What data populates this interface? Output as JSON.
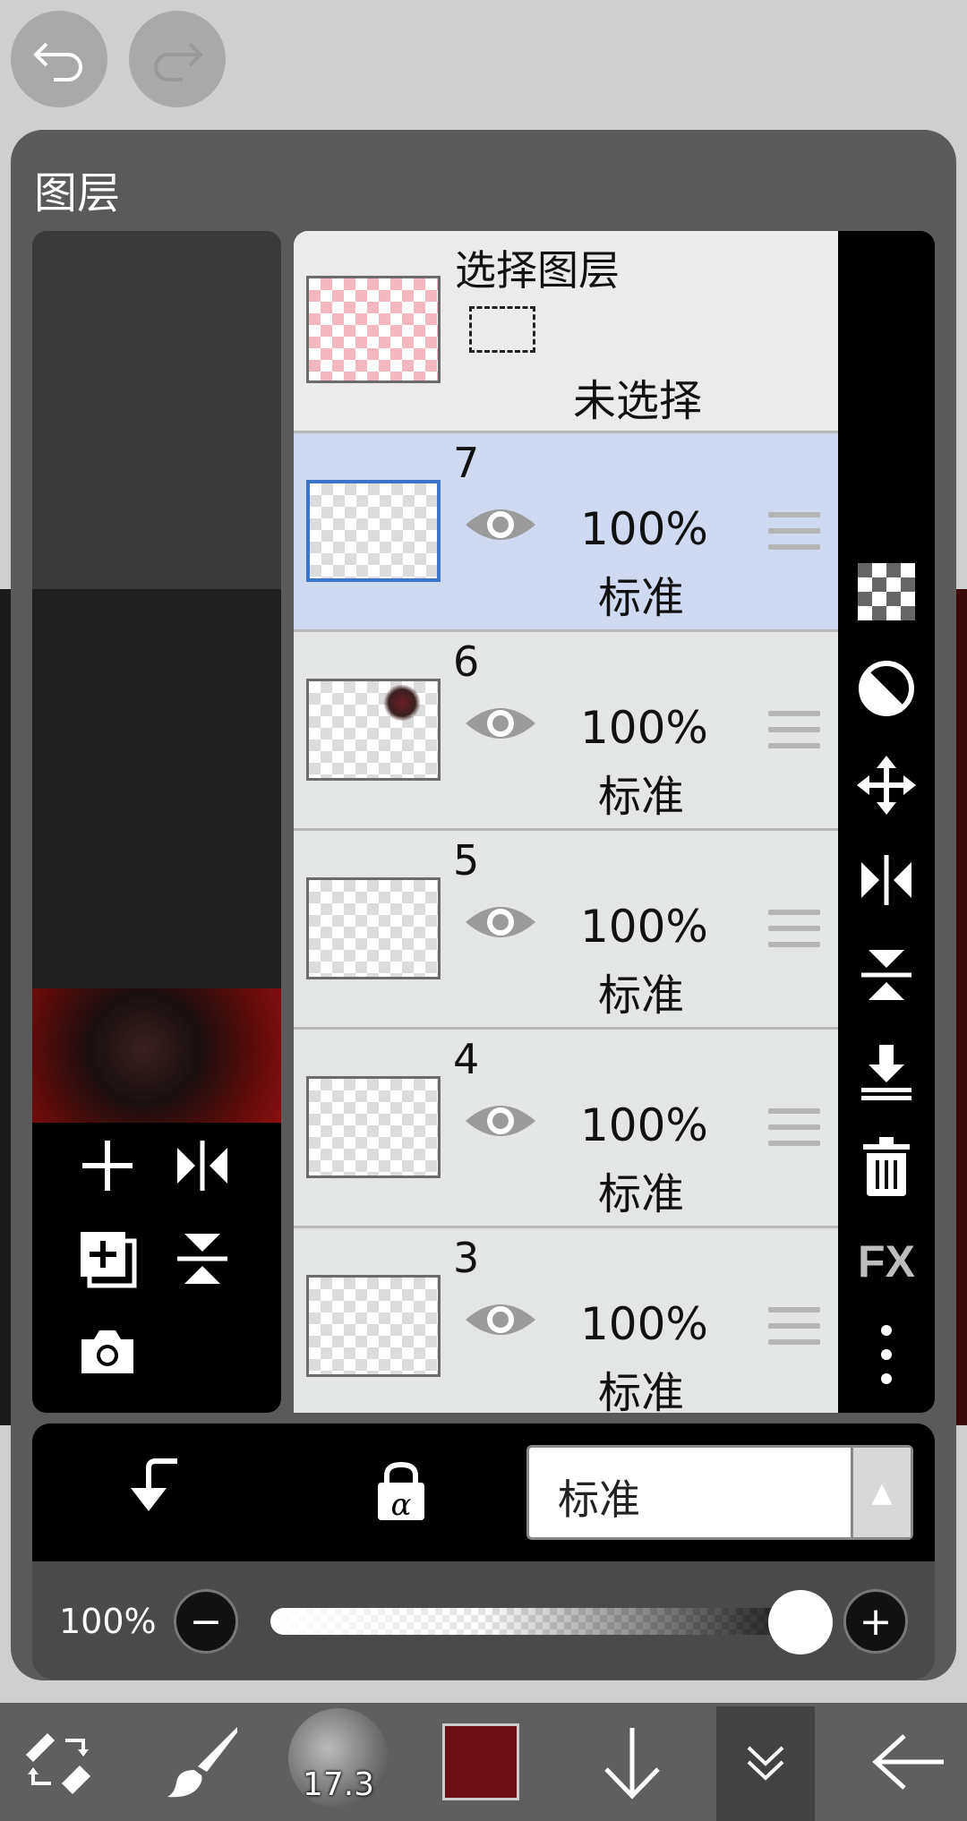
{
  "top": {
    "undo_icon": "undo-icon",
    "redo_icon": "redo-icon"
  },
  "panel": {
    "title": "图层"
  },
  "selection_layer": {
    "title": "选择图层",
    "status": "未选择"
  },
  "layers": [
    {
      "number": "7",
      "opacity": "100%",
      "mode": "标准",
      "selected": true
    },
    {
      "number": "6",
      "opacity": "100%",
      "mode": "标准",
      "selected": false
    },
    {
      "number": "5",
      "opacity": "100%",
      "mode": "标准",
      "selected": false
    },
    {
      "number": "4",
      "opacity": "100%",
      "mode": "标准",
      "selected": false
    },
    {
      "number": "3",
      "opacity": "100%",
      "mode": "标准",
      "selected": false
    }
  ],
  "right_tools": [
    "checker-icon",
    "contrast-icon",
    "move-icon",
    "flip-horizontal-icon",
    "flip-vertical-icon",
    "merge-down-icon",
    "trash-icon",
    "fx-icon",
    "more-icon"
  ],
  "fx_label": "FX",
  "blend": {
    "mode": "标准",
    "arrow": "▲"
  },
  "opacity": {
    "label": "100%",
    "minus": "−",
    "plus": "+",
    "value": 1.0
  },
  "toolbar": {
    "brush_size": "17.3",
    "color": "#6a0f16"
  }
}
